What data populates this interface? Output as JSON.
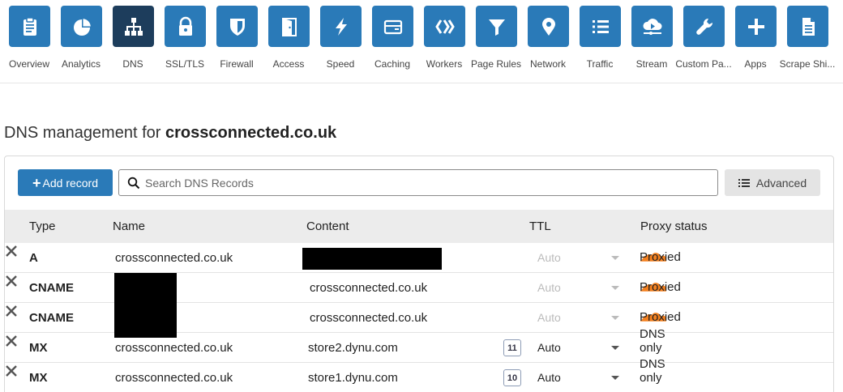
{
  "nav": {
    "items": [
      {
        "label": "Overview",
        "icon": "clipboard-icon",
        "active": false
      },
      {
        "label": "Analytics",
        "icon": "pie-chart-icon",
        "active": false
      },
      {
        "label": "DNS",
        "icon": "sitemap-icon",
        "active": true
      },
      {
        "label": "SSL/TLS",
        "icon": "lock-icon",
        "active": false
      },
      {
        "label": "Firewall",
        "icon": "shield-icon",
        "active": false
      },
      {
        "label": "Access",
        "icon": "door-icon",
        "active": false
      },
      {
        "label": "Speed",
        "icon": "lightning-icon",
        "active": false
      },
      {
        "label": "Caching",
        "icon": "server-icon",
        "active": false
      },
      {
        "label": "Workers",
        "icon": "workers-icon",
        "active": false
      },
      {
        "label": "Page Rules",
        "icon": "filter-icon",
        "active": false
      },
      {
        "label": "Network",
        "icon": "location-pin-icon",
        "active": false
      },
      {
        "label": "Traffic",
        "icon": "list-icon",
        "active": false
      },
      {
        "label": "Stream",
        "icon": "cloud-play-icon",
        "active": false
      },
      {
        "label": "Custom Pa...",
        "icon": "wrench-icon",
        "active": false
      },
      {
        "label": "Apps",
        "icon": "plus-icon",
        "active": false
      },
      {
        "label": "Scrape Shi...",
        "icon": "document-icon",
        "active": false
      }
    ]
  },
  "page": {
    "title_prefix": "DNS management for ",
    "domain": "crossconnected.co.uk"
  },
  "toolbar": {
    "add_label": "Add record",
    "add_plus": "+",
    "search_placeholder": "Search DNS Records",
    "advanced_label": "Advanced"
  },
  "table": {
    "headers": {
      "type": "Type",
      "name": "Name",
      "content": "Content",
      "ttl": "TTL",
      "proxy": "Proxy status"
    },
    "rows": [
      {
        "type": "A",
        "name": "crossconnected.co.uk",
        "content": "",
        "priority": "",
        "ttl": "Auto",
        "ttl_disabled": true,
        "proxy": "Proxied",
        "proxied": true
      },
      {
        "type": "CNAME",
        "name": "",
        "content": "crossconnected.co.uk",
        "priority": "",
        "ttl": "Auto",
        "ttl_disabled": true,
        "proxy": "Proxied",
        "proxied": true
      },
      {
        "type": "CNAME",
        "name": "",
        "content": "crossconnected.co.uk",
        "priority": "",
        "ttl": "Auto",
        "ttl_disabled": true,
        "proxy": "Proxied",
        "proxied": true
      },
      {
        "type": "MX",
        "name": "crossconnected.co.uk",
        "content": "store2.dynu.com",
        "priority": "11",
        "ttl": "Auto",
        "ttl_disabled": false,
        "proxy": "DNS only",
        "proxied": false
      },
      {
        "type": "MX",
        "name": "crossconnected.co.uk",
        "content": "store1.dynu.com",
        "priority": "10",
        "ttl": "Auto",
        "ttl_disabled": false,
        "proxy": "DNS only",
        "proxied": false
      }
    ]
  },
  "colors": {
    "accent": "#2a7ab8",
    "active_tile": "#1d3d5c",
    "proxied_cloud": "#f38020"
  }
}
